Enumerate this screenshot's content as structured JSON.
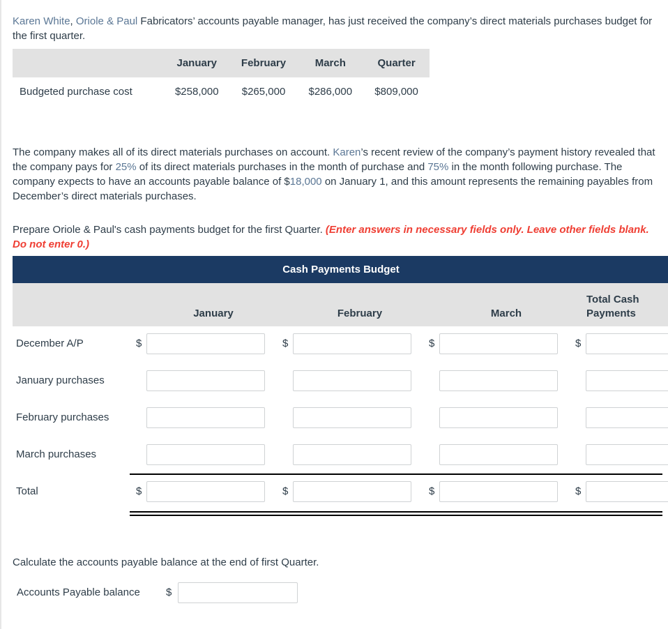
{
  "intro": {
    "name": "Karen White",
    "company": "Oriole & Paul",
    "rest": " Fabricators’ accounts payable manager, has just received the company’s direct materials purchases budget for the first quarter."
  },
  "facts_table": {
    "row_header_blank": "",
    "columns": [
      "January",
      "February",
      "March",
      "Quarter"
    ],
    "rows": [
      {
        "label": "Budgeted purchase cost",
        "values": [
          "$258,000",
          "$265,000",
          "$286,000",
          "$809,000"
        ]
      }
    ]
  },
  "body": {
    "seg1": "The company makes all of its direct materials purchases on account. ",
    "name": "Karen",
    "seg2": "’s recent review of the company’s payment history revealed that the company pays for ",
    "pct_current": "25%",
    "seg3": " of its direct materials purchases in the month of purchase and ",
    "pct_following": "75%",
    "seg4": " in the month following purchase. The company expects to have an accounts payable balance of $",
    "ap_balance": "18,000",
    "seg5": " on January 1, and this amount represents the remaining payables from December’s direct materials purchases."
  },
  "prepare": {
    "text": "Prepare Oriole & Paul's cash payments budget for the first Quarter. ",
    "note": "(Enter answers in necessary fields only. Leave other fields blank. Do not enter 0.)"
  },
  "budget": {
    "title": "Cash Payments Budget",
    "columns": [
      "January",
      "February",
      "March",
      "Total Cash Payments"
    ],
    "total_column_line1": "Total Cash",
    "total_column_line2": "Payments",
    "dollar_symbol": "$",
    "rows": [
      {
        "label": "December A/P",
        "show_dollar": true,
        "values": [
          "",
          "",
          "",
          ""
        ]
      },
      {
        "label": "January purchases",
        "show_dollar": false,
        "values": [
          "",
          "",
          "",
          ""
        ]
      },
      {
        "label": "February purchases",
        "show_dollar": false,
        "values": [
          "",
          "",
          "",
          ""
        ]
      },
      {
        "label": "March purchases",
        "show_dollar": false,
        "values": [
          "",
          "",
          "",
          ""
        ]
      },
      {
        "label": "Total",
        "show_dollar": true,
        "values": [
          "",
          "",
          "",
          ""
        ]
      }
    ]
  },
  "closing": {
    "question": "Calculate the accounts payable balance at the end of first Quarter.",
    "label": "Accounts Payable balance",
    "dollar_symbol": "$",
    "value": ""
  },
  "colors": {
    "header_navy": "#1b3a63",
    "band_gray": "#e2e2e2",
    "highlight_blue": "#5b7795",
    "note_red": "#ef3e33",
    "text": "#2e3d49"
  }
}
